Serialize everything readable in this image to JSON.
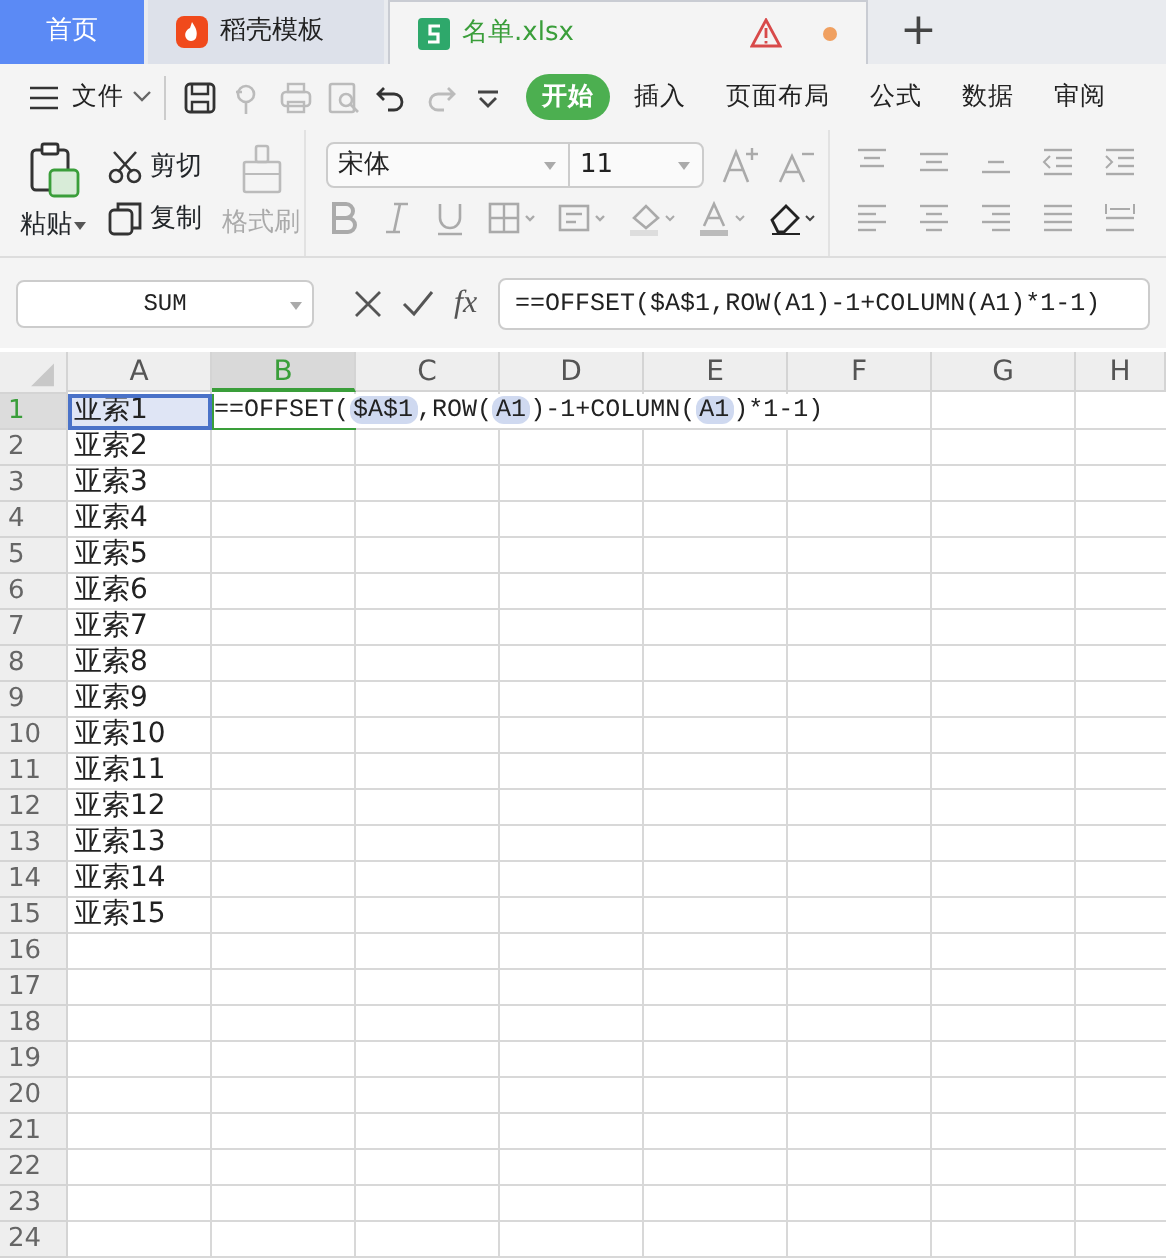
{
  "tabs": [
    {
      "label": "首页",
      "kind": "home",
      "selected": false
    },
    {
      "label": "稻壳模板",
      "kind": "docer",
      "selected": false
    },
    {
      "label": "名单.xlsx",
      "kind": "sheet",
      "selected": true,
      "warning": true,
      "unsaved": true
    }
  ],
  "new_tab": "+",
  "menu": {
    "file": "文件",
    "ribbon_tabs": [
      {
        "label": "开始",
        "selected": true
      },
      {
        "label": "插入",
        "selected": false
      },
      {
        "label": "页面布局",
        "selected": false
      },
      {
        "label": "公式",
        "selected": false
      },
      {
        "label": "数据",
        "selected": false
      },
      {
        "label": "审阅",
        "selected": false
      }
    ]
  },
  "ribbon": {
    "paste": "粘贴",
    "cut": "剪切",
    "copy": "复制",
    "format_painter": "格式刷",
    "font": "宋体",
    "size": "11"
  },
  "formula_bar": {
    "name_box": "SUM",
    "fx": "fx",
    "content": "==OFFSET($A$1,ROW(A1)-1+COLUMN(A1)*1-1)"
  },
  "columns": [
    {
      "label": "A",
      "selected": false
    },
    {
      "label": "B",
      "selected": true
    },
    {
      "label": "C",
      "selected": false
    },
    {
      "label": "D",
      "selected": false
    },
    {
      "label": "E",
      "selected": false
    },
    {
      "label": "F",
      "selected": false
    },
    {
      "label": "G",
      "selected": false
    },
    {
      "label": "H",
      "selected": false
    }
  ],
  "rows": [
    {
      "number": "1",
      "a": "亚索1",
      "selected": true
    },
    {
      "number": "2",
      "a": "亚索2",
      "selected": false
    },
    {
      "number": "3",
      "a": "亚索3",
      "selected": false
    },
    {
      "number": "4",
      "a": "亚索4",
      "selected": false
    },
    {
      "number": "5",
      "a": "亚索5",
      "selected": false
    },
    {
      "number": "6",
      "a": "亚索6",
      "selected": false
    },
    {
      "number": "7",
      "a": "亚索7",
      "selected": false
    },
    {
      "number": "8",
      "a": "亚索8",
      "selected": false
    },
    {
      "number": "9",
      "a": "亚索9",
      "selected": false
    },
    {
      "number": "10",
      "a": "亚索10",
      "selected": false
    },
    {
      "number": "11",
      "a": "亚索11",
      "selected": false
    },
    {
      "number": "12",
      "a": "亚索12",
      "selected": false
    },
    {
      "number": "13",
      "a": "亚索13",
      "selected": false
    },
    {
      "number": "14",
      "a": "亚索14",
      "selected": false
    },
    {
      "number": "15",
      "a": "亚索15",
      "selected": false
    },
    {
      "number": "16",
      "selected": false
    },
    {
      "number": "17",
      "selected": false
    },
    {
      "number": "18",
      "selected": false
    },
    {
      "number": "19",
      "selected": false
    },
    {
      "number": "20",
      "selected": false
    },
    {
      "number": "21",
      "selected": false
    },
    {
      "number": "22",
      "selected": false
    },
    {
      "number": "23",
      "selected": false
    },
    {
      "number": "24",
      "selected": false
    }
  ],
  "editing_cell": [
    {
      "text": "==OFFSET(",
      "kind": "plain"
    },
    {
      "text": "$A$1",
      "kind": "ref"
    },
    {
      "text": ",ROW(",
      "kind": "plain"
    },
    {
      "text": "A1",
      "kind": "ref"
    },
    {
      "text": ")-1+COLUMN(",
      "kind": "plain"
    },
    {
      "text": "A1",
      "kind": "ref"
    },
    {
      "text": ")*1-1)",
      "kind": "plain"
    }
  ]
}
